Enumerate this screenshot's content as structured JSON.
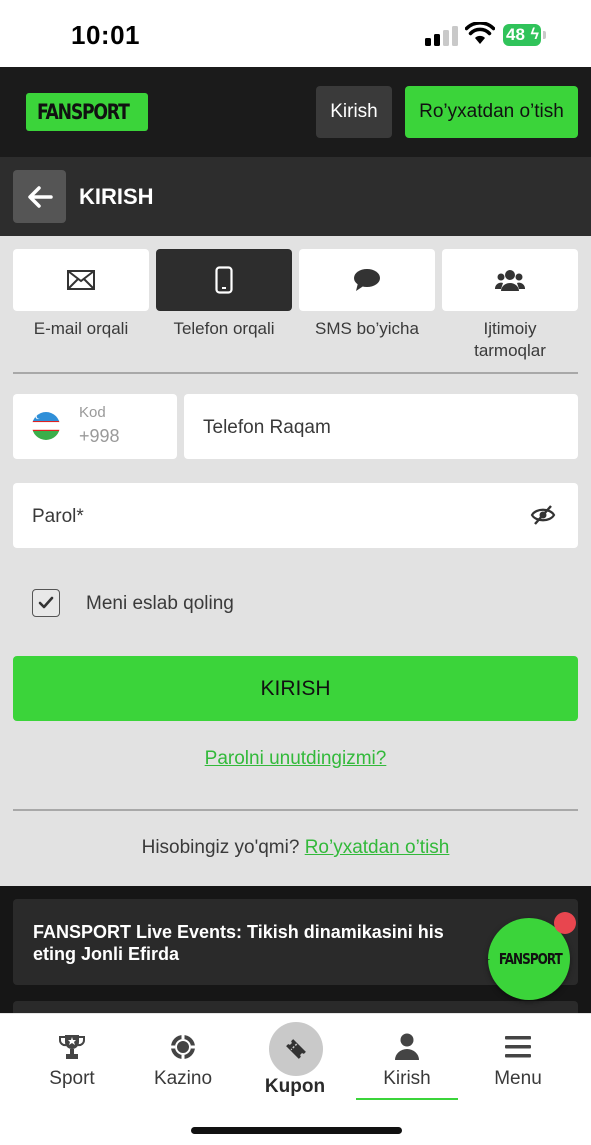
{
  "status_bar": {
    "time": "10:01",
    "battery": "48"
  },
  "header": {
    "logo_text": "FANSPORT",
    "login_label": "Kirish",
    "register_label": "Ro’yxatdan o’tish"
  },
  "titlebar": {
    "title": "KIRISH"
  },
  "tabs": [
    {
      "label": "E-mail orqali",
      "icon": "envelope-icon",
      "active": false
    },
    {
      "label": "Telefon orqali",
      "icon": "phone-icon",
      "active": true
    },
    {
      "label": "SMS bo’yicha",
      "icon": "chat-bubble-icon",
      "active": false
    },
    {
      "label": "Ijtimoiy tarmoqlar",
      "icon": "users-icon",
      "active": false
    }
  ],
  "form": {
    "code_caption": "Kod",
    "code_value": "+998",
    "phone_placeholder": "Telefon Raqam",
    "password_placeholder": "Parol*",
    "remember_label": "Meni eslab qoling",
    "remember_checked": true,
    "submit_label": "KIRISH",
    "forgot_label": "Parolni unutdingizmi?",
    "no_account_text": "Hisobingiz yo'qmi?",
    "register_link": "Ro’yxatdan o’tish"
  },
  "promo": {
    "text": "FANSPORT Live Events: Tikish dinamikasini his eting Jonli Efirda",
    "fab_text": "FANSPORT"
  },
  "bottom_nav": {
    "items": [
      {
        "label": "Sport",
        "icon": "trophy-icon"
      },
      {
        "label": "Kazino",
        "icon": "casino-chip-icon"
      },
      {
        "label": "Kupon",
        "icon": "ticket-icon"
      },
      {
        "label": "Kirish",
        "icon": "user-icon",
        "active": true
      },
      {
        "label": "Menu",
        "icon": "hamburger-icon"
      }
    ]
  },
  "colors": {
    "accent": "#3bd43a",
    "header_bg": "#1b1b1b",
    "titlebar_bg": "#2d2d2d",
    "content_bg": "#e2e2e2",
    "link": "#32b93a"
  }
}
